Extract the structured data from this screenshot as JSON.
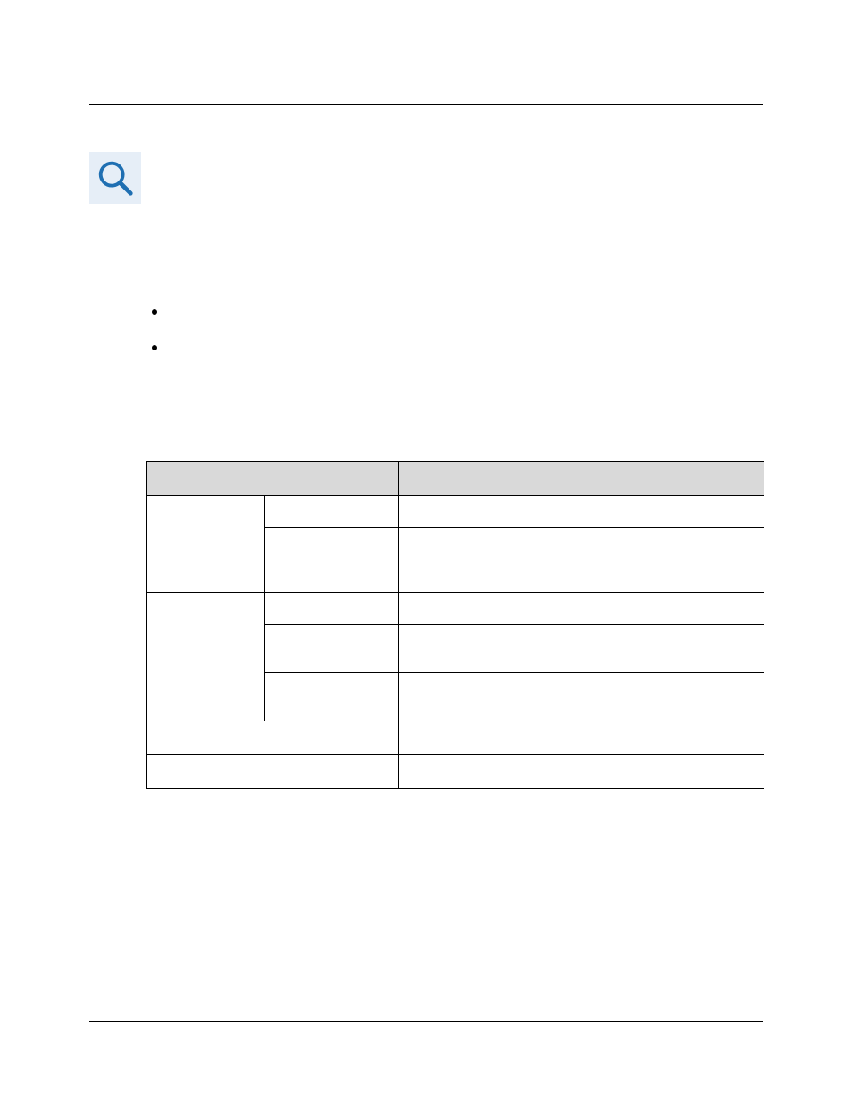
{
  "icon": {
    "name": "magnifier-icon"
  },
  "bullets": [
    "",
    ""
  ],
  "table": {
    "header": [
      "",
      ""
    ],
    "rows": [
      {
        "group": "",
        "sub": "",
        "val": ""
      },
      {
        "group": null,
        "sub": "",
        "val": ""
      },
      {
        "group": null,
        "sub": "",
        "val": ""
      },
      {
        "group": "",
        "sub": "",
        "val": ""
      },
      {
        "group": null,
        "sub": "",
        "val": ""
      },
      {
        "group": null,
        "sub": "",
        "val": ""
      },
      {
        "span": "",
        "val": ""
      },
      {
        "span": "",
        "val": ""
      }
    ]
  }
}
